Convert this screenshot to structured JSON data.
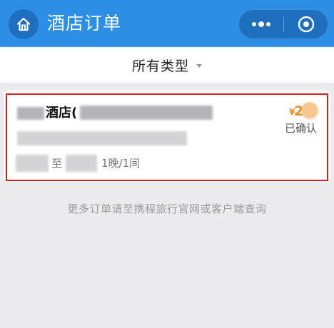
{
  "header": {
    "title": "酒店订单",
    "home_icon": "home-icon",
    "more_icon": "more-dots-icon",
    "close_icon": "target-close-icon",
    "bar_color": "#2d8ee6"
  },
  "filter": {
    "selected": "所有类型",
    "arrow_icon": "chevron-down-icon"
  },
  "order": {
    "hotel_name_visible": "酒店(",
    "price_symbol": "¥",
    "price_visible": "2",
    "status": "已确认",
    "date_separator": "至",
    "nights_rooms": "1晚/1间",
    "highlight_color": "#d42020",
    "price_color": "#f08a1c"
  },
  "footer": {
    "note": "更多订单请至携程旅行官网或客户端查询"
  }
}
